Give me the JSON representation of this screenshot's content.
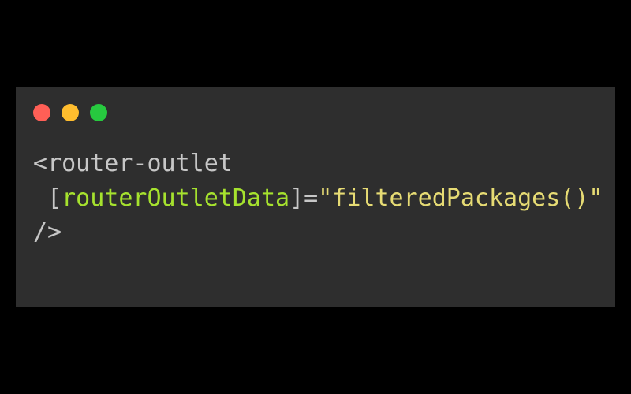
{
  "code": {
    "line1_open_bracket": "<",
    "line1_tag": "router-outlet",
    "line2_attr_open": "[",
    "line2_attr_name": "routerOutletData",
    "line2_attr_close": "]",
    "line2_eq": "=",
    "line2_quote_open": "\"",
    "line2_value": "filteredPackages()",
    "line2_quote_close": "\"",
    "line3_close": "/>"
  },
  "window": {
    "traffic_lights": [
      "red",
      "yellow",
      "green"
    ]
  }
}
